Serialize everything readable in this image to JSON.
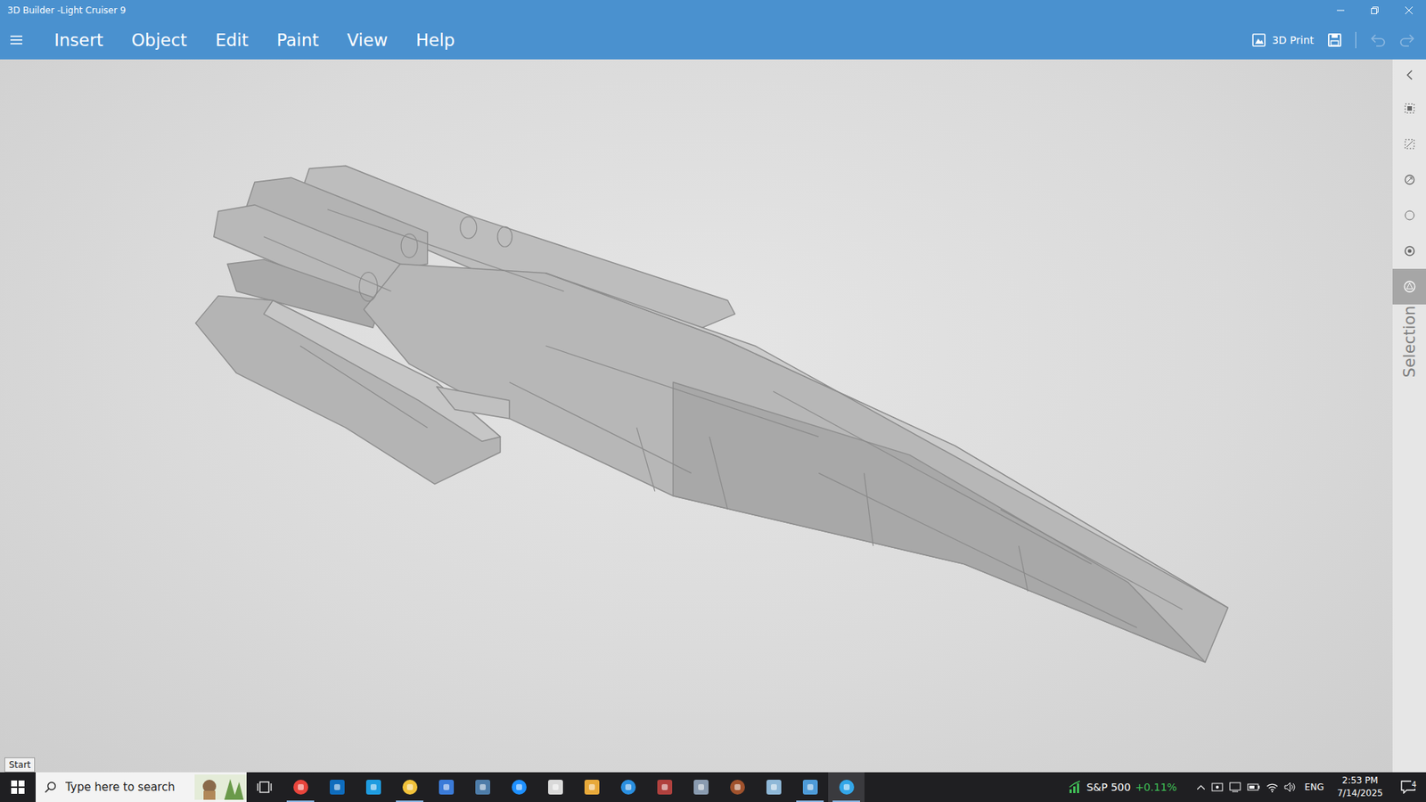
{
  "window": {
    "title": "3D Builder -Light Cruiser 9"
  },
  "menu": {
    "items": [
      "Insert",
      "Object",
      "Edit",
      "Paint",
      "View",
      "Help"
    ]
  },
  "toolbar": {
    "print_label": "3D Print",
    "undo_disabled": true,
    "redo_disabled": true
  },
  "side_panel": {
    "tools": [
      {
        "selected": false
      },
      {
        "selected": false
      },
      {
        "selected": false
      },
      {
        "selected": false
      },
      {
        "selected": false
      },
      {
        "selected": true
      }
    ],
    "label": "Selection"
  },
  "tooltip": "Start",
  "taskbar": {
    "search_placeholder": "Type here to search",
    "apps": [
      {
        "color": "#e8453c",
        "running": true,
        "selected": false
      },
      {
        "color": "#0f6cbd",
        "running": false,
        "selected": false
      },
      {
        "color": "#1f9ce0",
        "running": false,
        "selected": false
      },
      {
        "color": "#f2c23a",
        "running": true,
        "selected": false
      },
      {
        "color": "#3b7bd8",
        "running": false,
        "selected": false
      },
      {
        "color": "#4e7ca8",
        "running": false,
        "selected": false
      },
      {
        "color": "#1e90ff",
        "running": false,
        "selected": false
      },
      {
        "color": "#d9d9d9",
        "running": false,
        "selected": false
      },
      {
        "color": "#e8a93a",
        "running": false,
        "selected": false
      },
      {
        "color": "#2a8fe0",
        "running": false,
        "selected": false
      },
      {
        "color": "#b0413e",
        "running": false,
        "selected": false
      },
      {
        "color": "#8a9bb0",
        "running": false,
        "selected": false
      },
      {
        "color": "#a0522d",
        "running": false,
        "selected": false
      },
      {
        "color": "#8fb8d8",
        "running": false,
        "selected": false
      },
      {
        "color": "#4e9bd8",
        "running": true,
        "selected": false
      },
      {
        "color": "#33a6e8",
        "running": true,
        "selected": true
      }
    ]
  },
  "widget": {
    "label": "S&P 500",
    "change": "+0.11%"
  },
  "tray": {
    "language": "ENG",
    "time": "2:53 PM",
    "date": "7/14/2025",
    "notifications": "4"
  }
}
